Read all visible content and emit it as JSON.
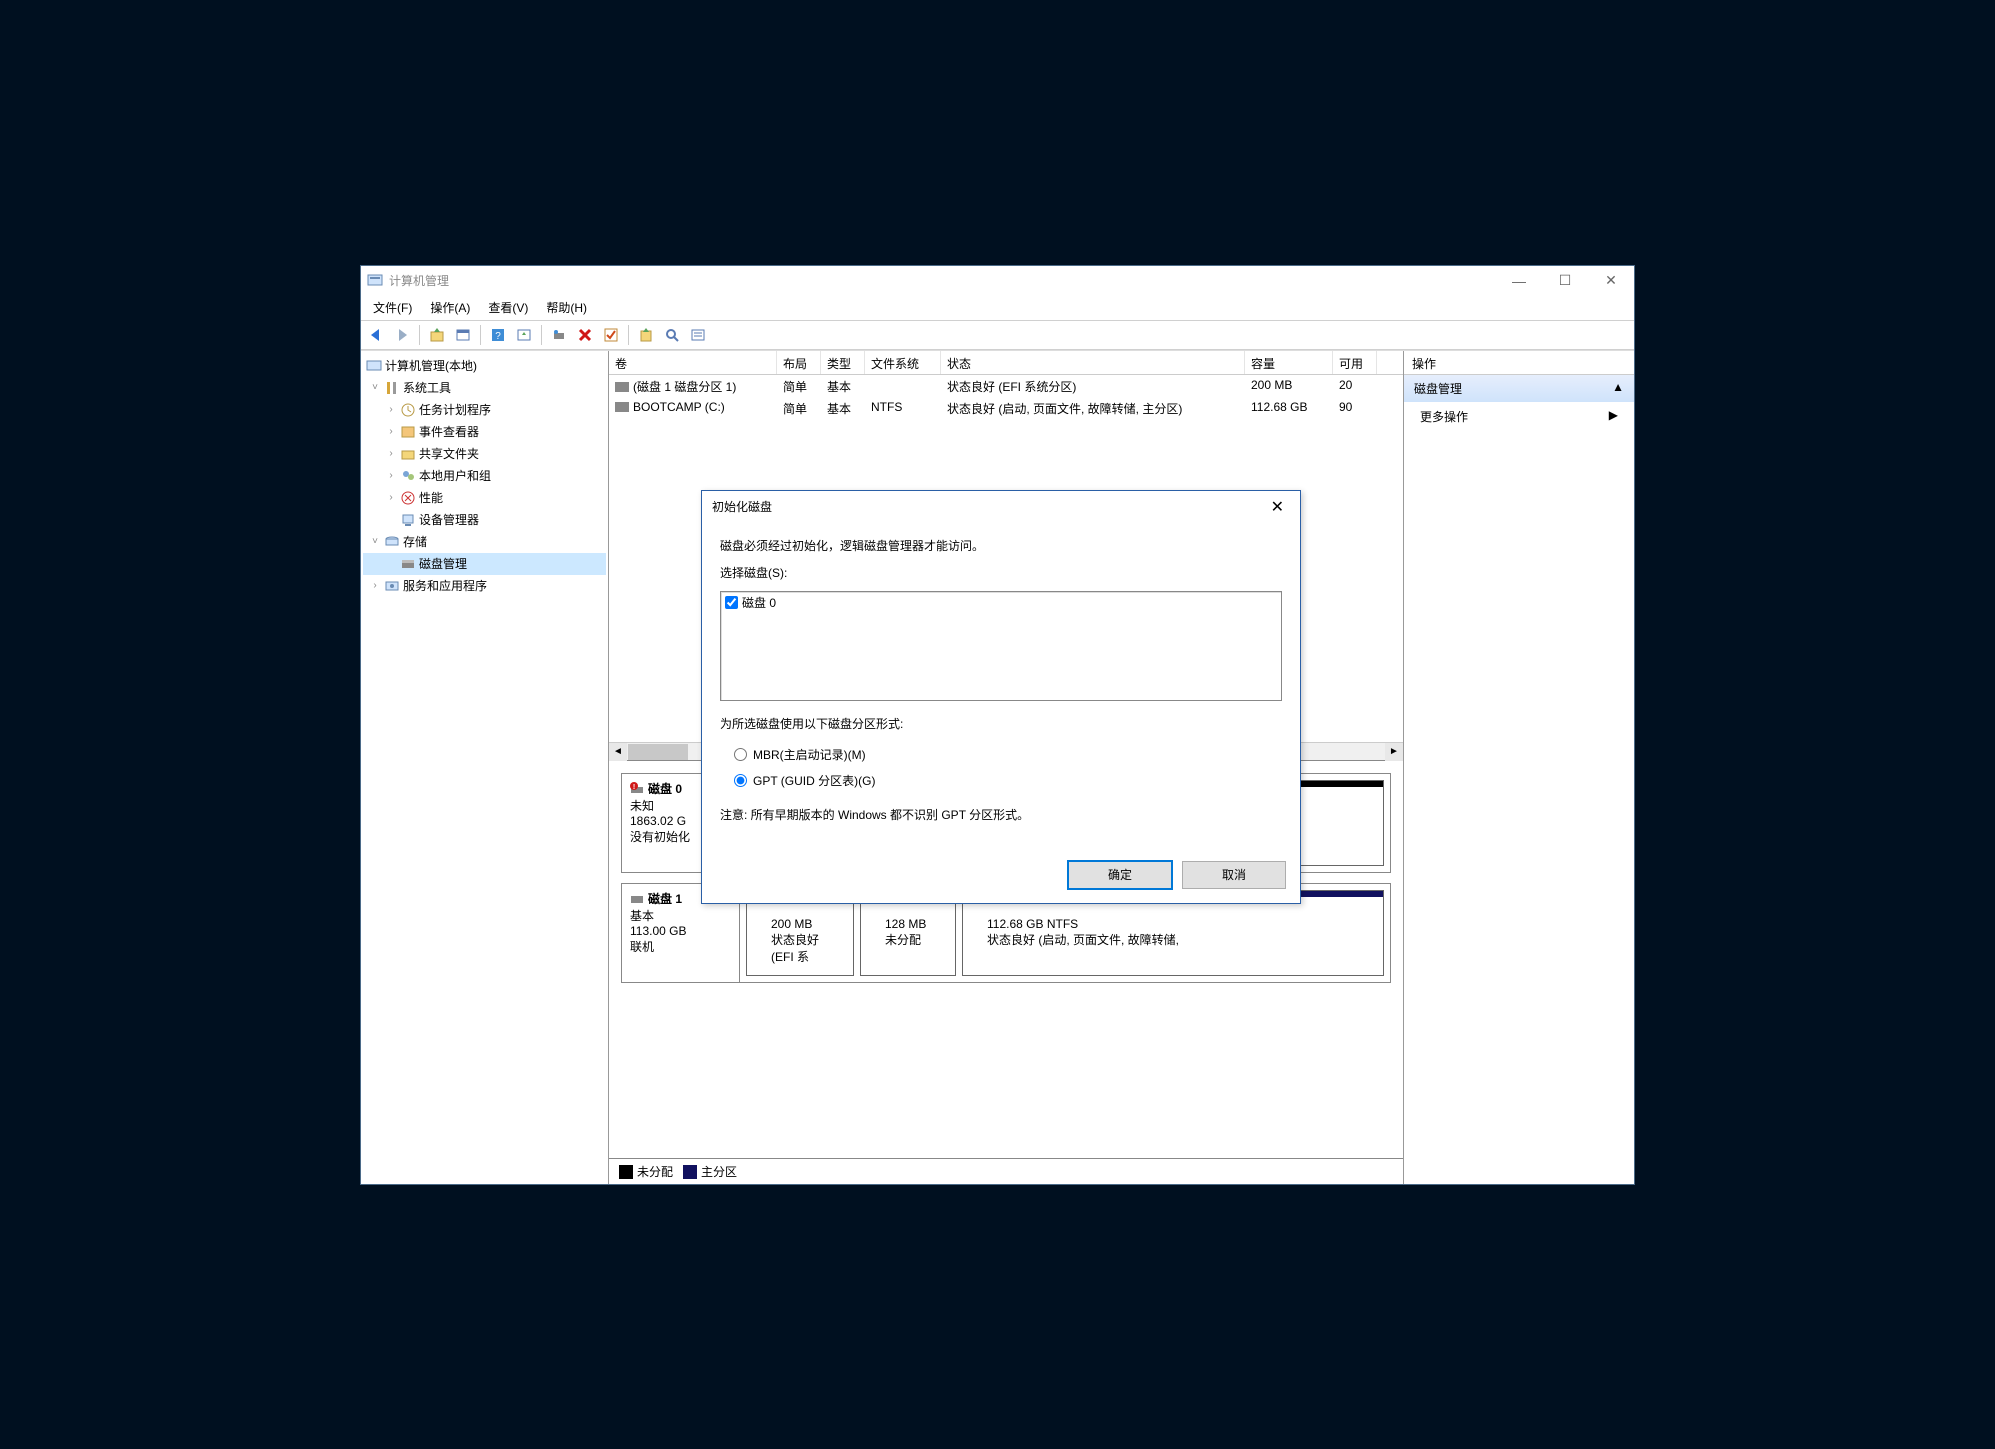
{
  "window": {
    "title": "计算机管理"
  },
  "menu": {
    "file": "文件(F)",
    "action": "操作(A)",
    "view": "查看(V)",
    "help": "帮助(H)"
  },
  "tree": {
    "root": "计算机管理(本地)",
    "system_tools": "系统工具",
    "system_tools_items": [
      "任务计划程序",
      "事件查看器",
      "共享文件夹",
      "本地用户和组",
      "性能",
      "设备管理器"
    ],
    "storage": "存储",
    "disk_mgmt": "磁盘管理",
    "services": "服务和应用程序"
  },
  "vol_headers": {
    "vol": "卷",
    "layout": "布局",
    "type": "类型",
    "fs": "文件系统",
    "status": "状态",
    "cap": "容量",
    "avail": "可用"
  },
  "volumes": [
    {
      "name": "(磁盘 1 磁盘分区 1)",
      "layout": "简单",
      "type": "基本",
      "fs": "",
      "status": "状态良好 (EFI 系统分区)",
      "cap": "200 MB",
      "avail": "20"
    },
    {
      "name": "BOOTCAMP (C:)",
      "layout": "简单",
      "type": "基本",
      "fs": "NTFS",
      "status": "状态良好 (启动, 页面文件, 故障转储, 主分区)",
      "cap": "112.68 GB",
      "avail": "90"
    }
  ],
  "disks": [
    {
      "name": "磁盘 0",
      "lines": [
        "未知",
        "1863.02 G",
        "没有初始化"
      ],
      "parts": [
        {
          "kind": "black",
          "line1": "",
          "line2": ""
        }
      ],
      "err": true
    },
    {
      "name": "磁盘 1",
      "lines": [
        "基本",
        "113.00 GB",
        "联机"
      ],
      "parts": [
        {
          "kind": "un",
          "line1": "200 MB",
          "line2": "状态良好 (EFI 系"
        },
        {
          "kind": "un",
          "line1": "128 MB",
          "line2": "未分配"
        },
        {
          "kind": "pri",
          "line0": "",
          "line1": "112.68 GB NTFS",
          "line2": "状态良好 (启动, 页面文件, 故障转储,"
        }
      ]
    }
  ],
  "legend": {
    "unalloc": "未分配",
    "primary": "主分区"
  },
  "actions": {
    "header": "操作",
    "group": "磁盘管理",
    "more": "更多操作"
  },
  "dialog": {
    "title": "初始化磁盘",
    "intro": "磁盘必须经过初始化，逻辑磁盘管理器才能访问。",
    "select_label": "选择磁盘(S):",
    "disk0": "磁盘 0",
    "style_label": "为所选磁盘使用以下磁盘分区形式:",
    "mbr": "MBR(主启动记录)(M)",
    "gpt": "GPT (GUID 分区表)(G)",
    "note": "注意: 所有早期版本的 Windows 都不识别 GPT 分区形式。",
    "ok": "确定",
    "cancel": "取消"
  }
}
